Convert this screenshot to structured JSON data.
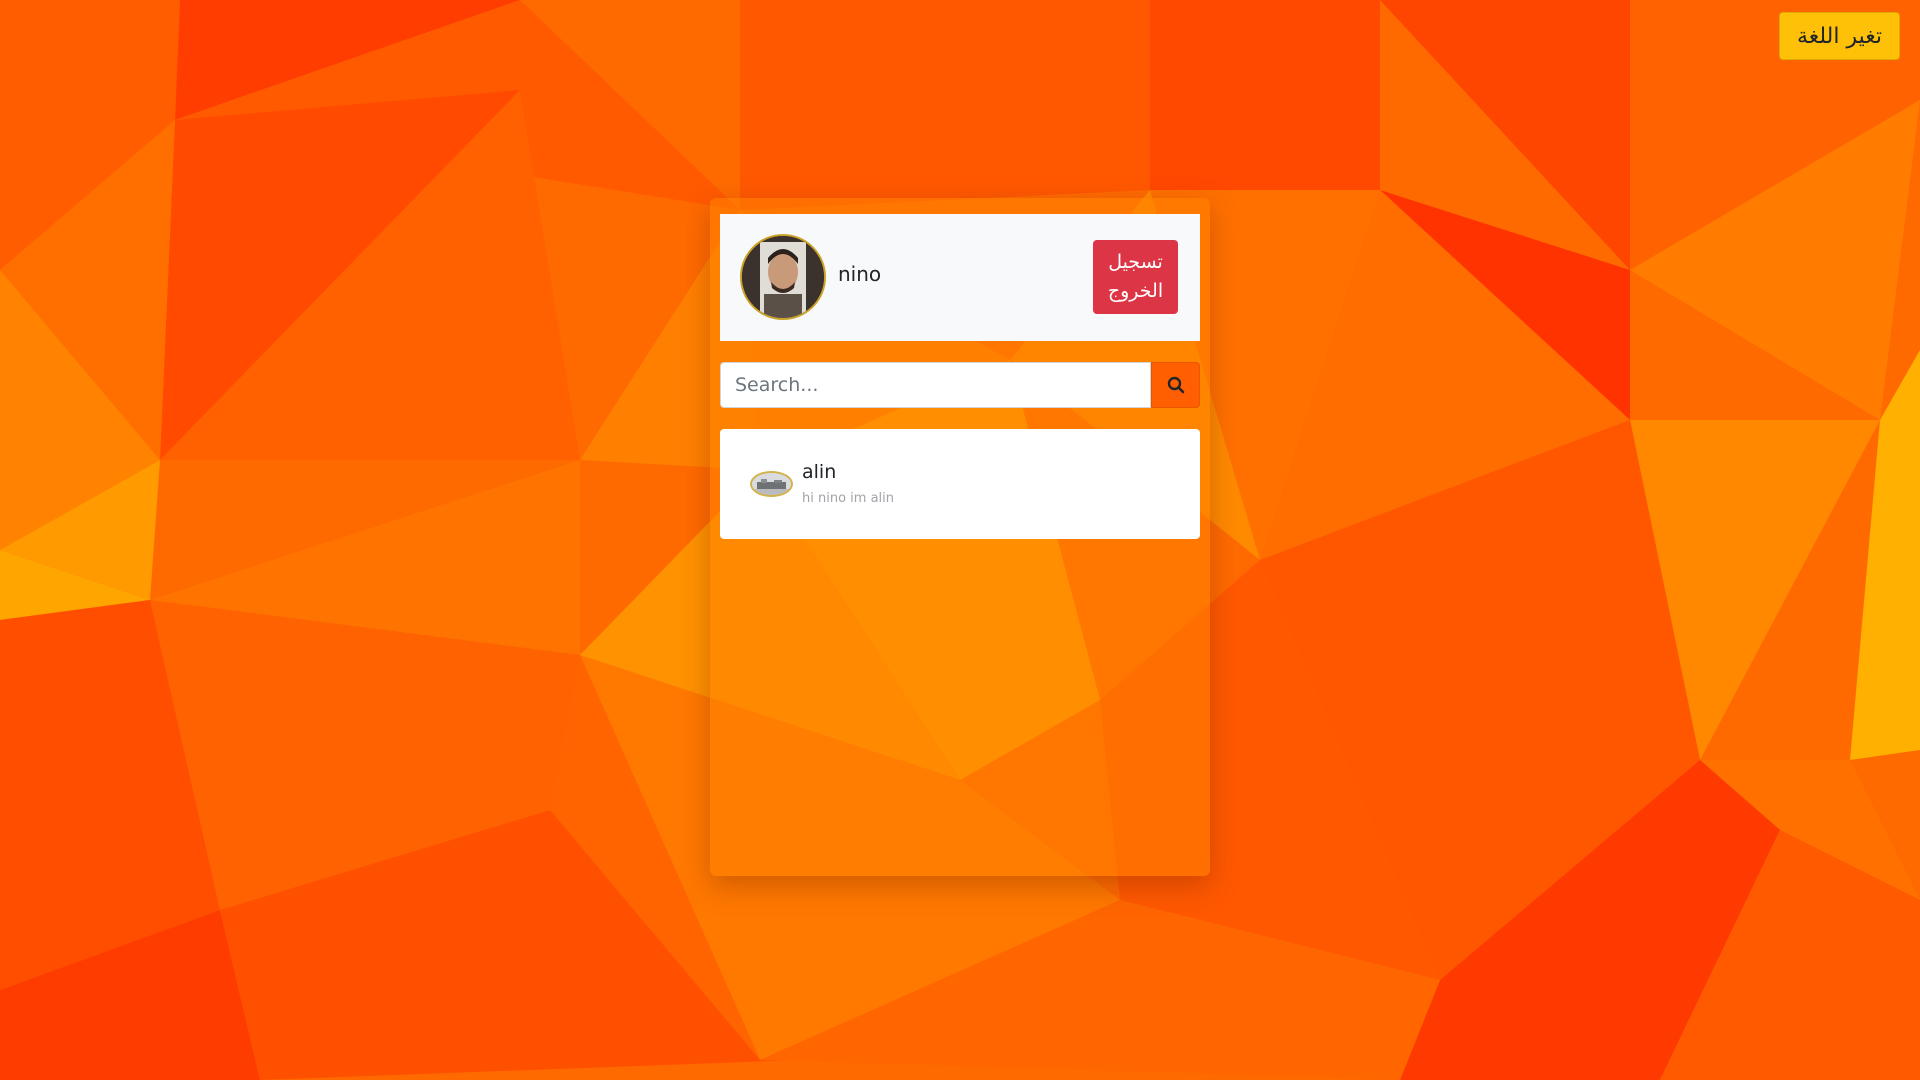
{
  "header_bar": {
    "language_button_label": "تغير اللغة"
  },
  "chat": {
    "current_user": {
      "name": "nino"
    },
    "logout_label": "تسجيل الخروج",
    "search": {
      "placeholder": "Search...",
      "value": ""
    },
    "contacts": [
      {
        "name": "alin",
        "last_message": "hi nino im alin"
      }
    ]
  },
  "icons": {
    "search": "search-icon",
    "avatar": "avatar"
  },
  "colors": {
    "background_accent": "#ff6a00",
    "language_button": "#ffc107",
    "logout_button": "#dc3545",
    "search_button": "#ff5f00",
    "header_bg": "#f8f9fa"
  }
}
